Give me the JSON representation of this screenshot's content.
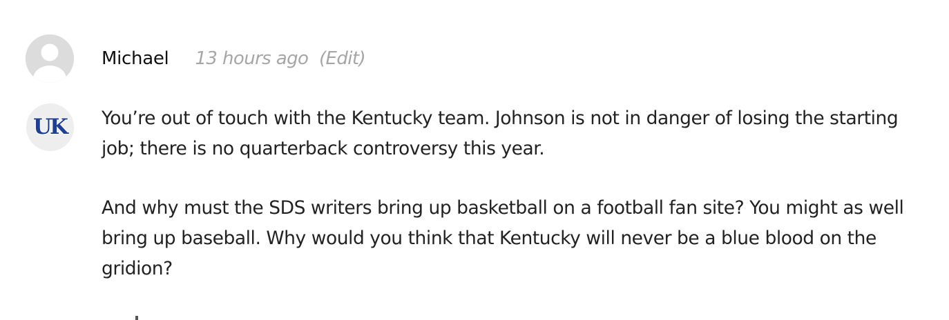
{
  "comment": {
    "author": "Michael",
    "timestamp": "13 hours ago",
    "edit_label": "(Edit)",
    "paragraphs": [
      "You’re out of touch with the Kentucky team. Johnson is not in danger of losing the starting job; there is no quarterback controversy this year.",
      "And why must the SDS writers bring up basketball on a football fan site? You might as well bring up baseball. Why would you think that Kentucky will never be a blue blood on the gridion?"
    ]
  },
  "avatars": {
    "default_icon": "default-user-icon",
    "team_logo": {
      "text": "UK",
      "color": "#1f3f94"
    }
  },
  "colors": {
    "author": "#111111",
    "meta": "#a6a6a6",
    "body_text": "#222222",
    "avatar_bg": "#dcdcdc"
  }
}
